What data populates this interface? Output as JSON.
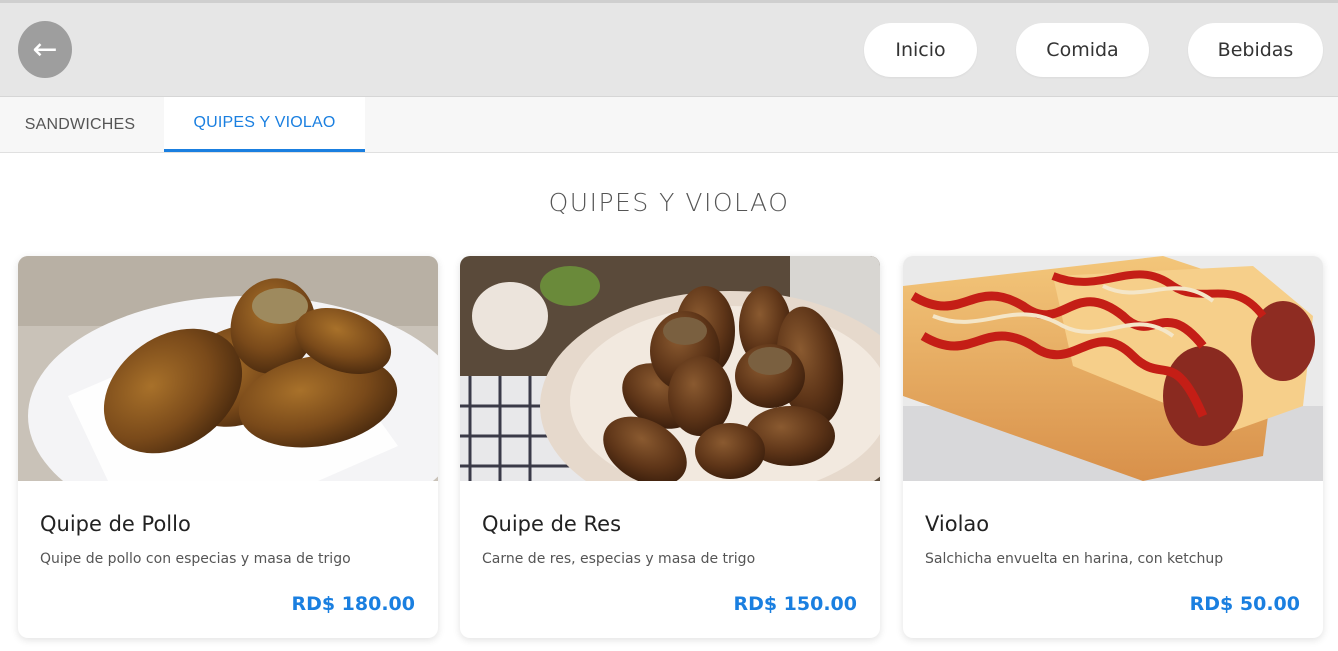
{
  "header": {
    "back_icon": "←",
    "nav": {
      "inicio": "Inicio",
      "comida": "Comida",
      "bebidas": "Bebidas"
    }
  },
  "tabs": [
    {
      "label": "SANDWICHES",
      "active": false
    },
    {
      "label": "QUIPES Y VIOLAO",
      "active": true
    }
  ],
  "section": {
    "title": "QUIPES Y VIOLAO"
  },
  "products": [
    {
      "name": "Quipe de Pollo",
      "description": "Quipe de pollo con especias y masa de trigo",
      "price": "RD$ 180.00"
    },
    {
      "name": "Quipe de Res",
      "description": "Carne de res, especias y masa de trigo",
      "price": "RD$ 150.00"
    },
    {
      "name": "Violao",
      "description": "Salchicha envuelta en harina, con ketchup",
      "price": "RD$ 50.00"
    }
  ],
  "colors": {
    "accent": "#1a7fe0",
    "header_bg": "#e6e6e6",
    "back_button": "#9e9e9e"
  }
}
